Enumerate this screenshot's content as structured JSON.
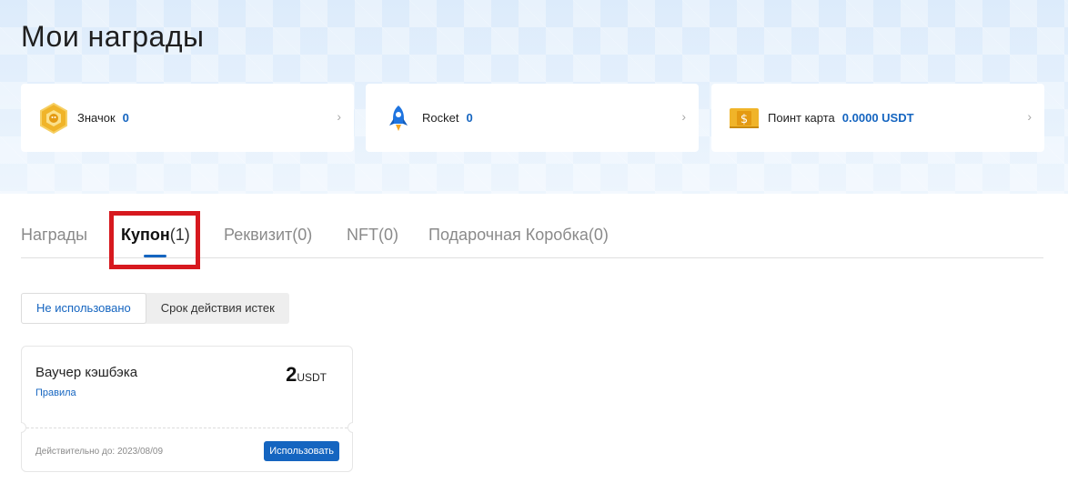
{
  "header": {
    "title": "Мои награды"
  },
  "summary": [
    {
      "icon": "badge-hexagon-icon",
      "label": "Значок",
      "value": "0"
    },
    {
      "icon": "rocket-icon",
      "label": "Rocket",
      "value": "0"
    },
    {
      "icon": "point-card-icon",
      "label": "Поинт карта",
      "value": "0.0000 USDT"
    }
  ],
  "tabs": [
    {
      "name": "Награды",
      "count": ""
    },
    {
      "name": "Купон",
      "count": "(1)"
    },
    {
      "name": "Реквизит",
      "count": "(0)"
    },
    {
      "name": "NFT",
      "count": "(0)"
    },
    {
      "name": "Подарочная Коробка",
      "count": "(0)"
    }
  ],
  "active_tab": "Купон",
  "filter": {
    "unused": "Не использовано",
    "expired": "Срок действия истек",
    "active": "Не использовано"
  },
  "coupon": {
    "title": "Ваучер кэшбэка",
    "rules": "Правила",
    "amount": "2",
    "unit": "USDT",
    "valid_until": "Действительно до: 2023/08/09",
    "use_label": "Использовать"
  },
  "colors": {
    "accent": "#1565c0",
    "highlight": "#d7191f",
    "hero": "#e6f1fc"
  }
}
